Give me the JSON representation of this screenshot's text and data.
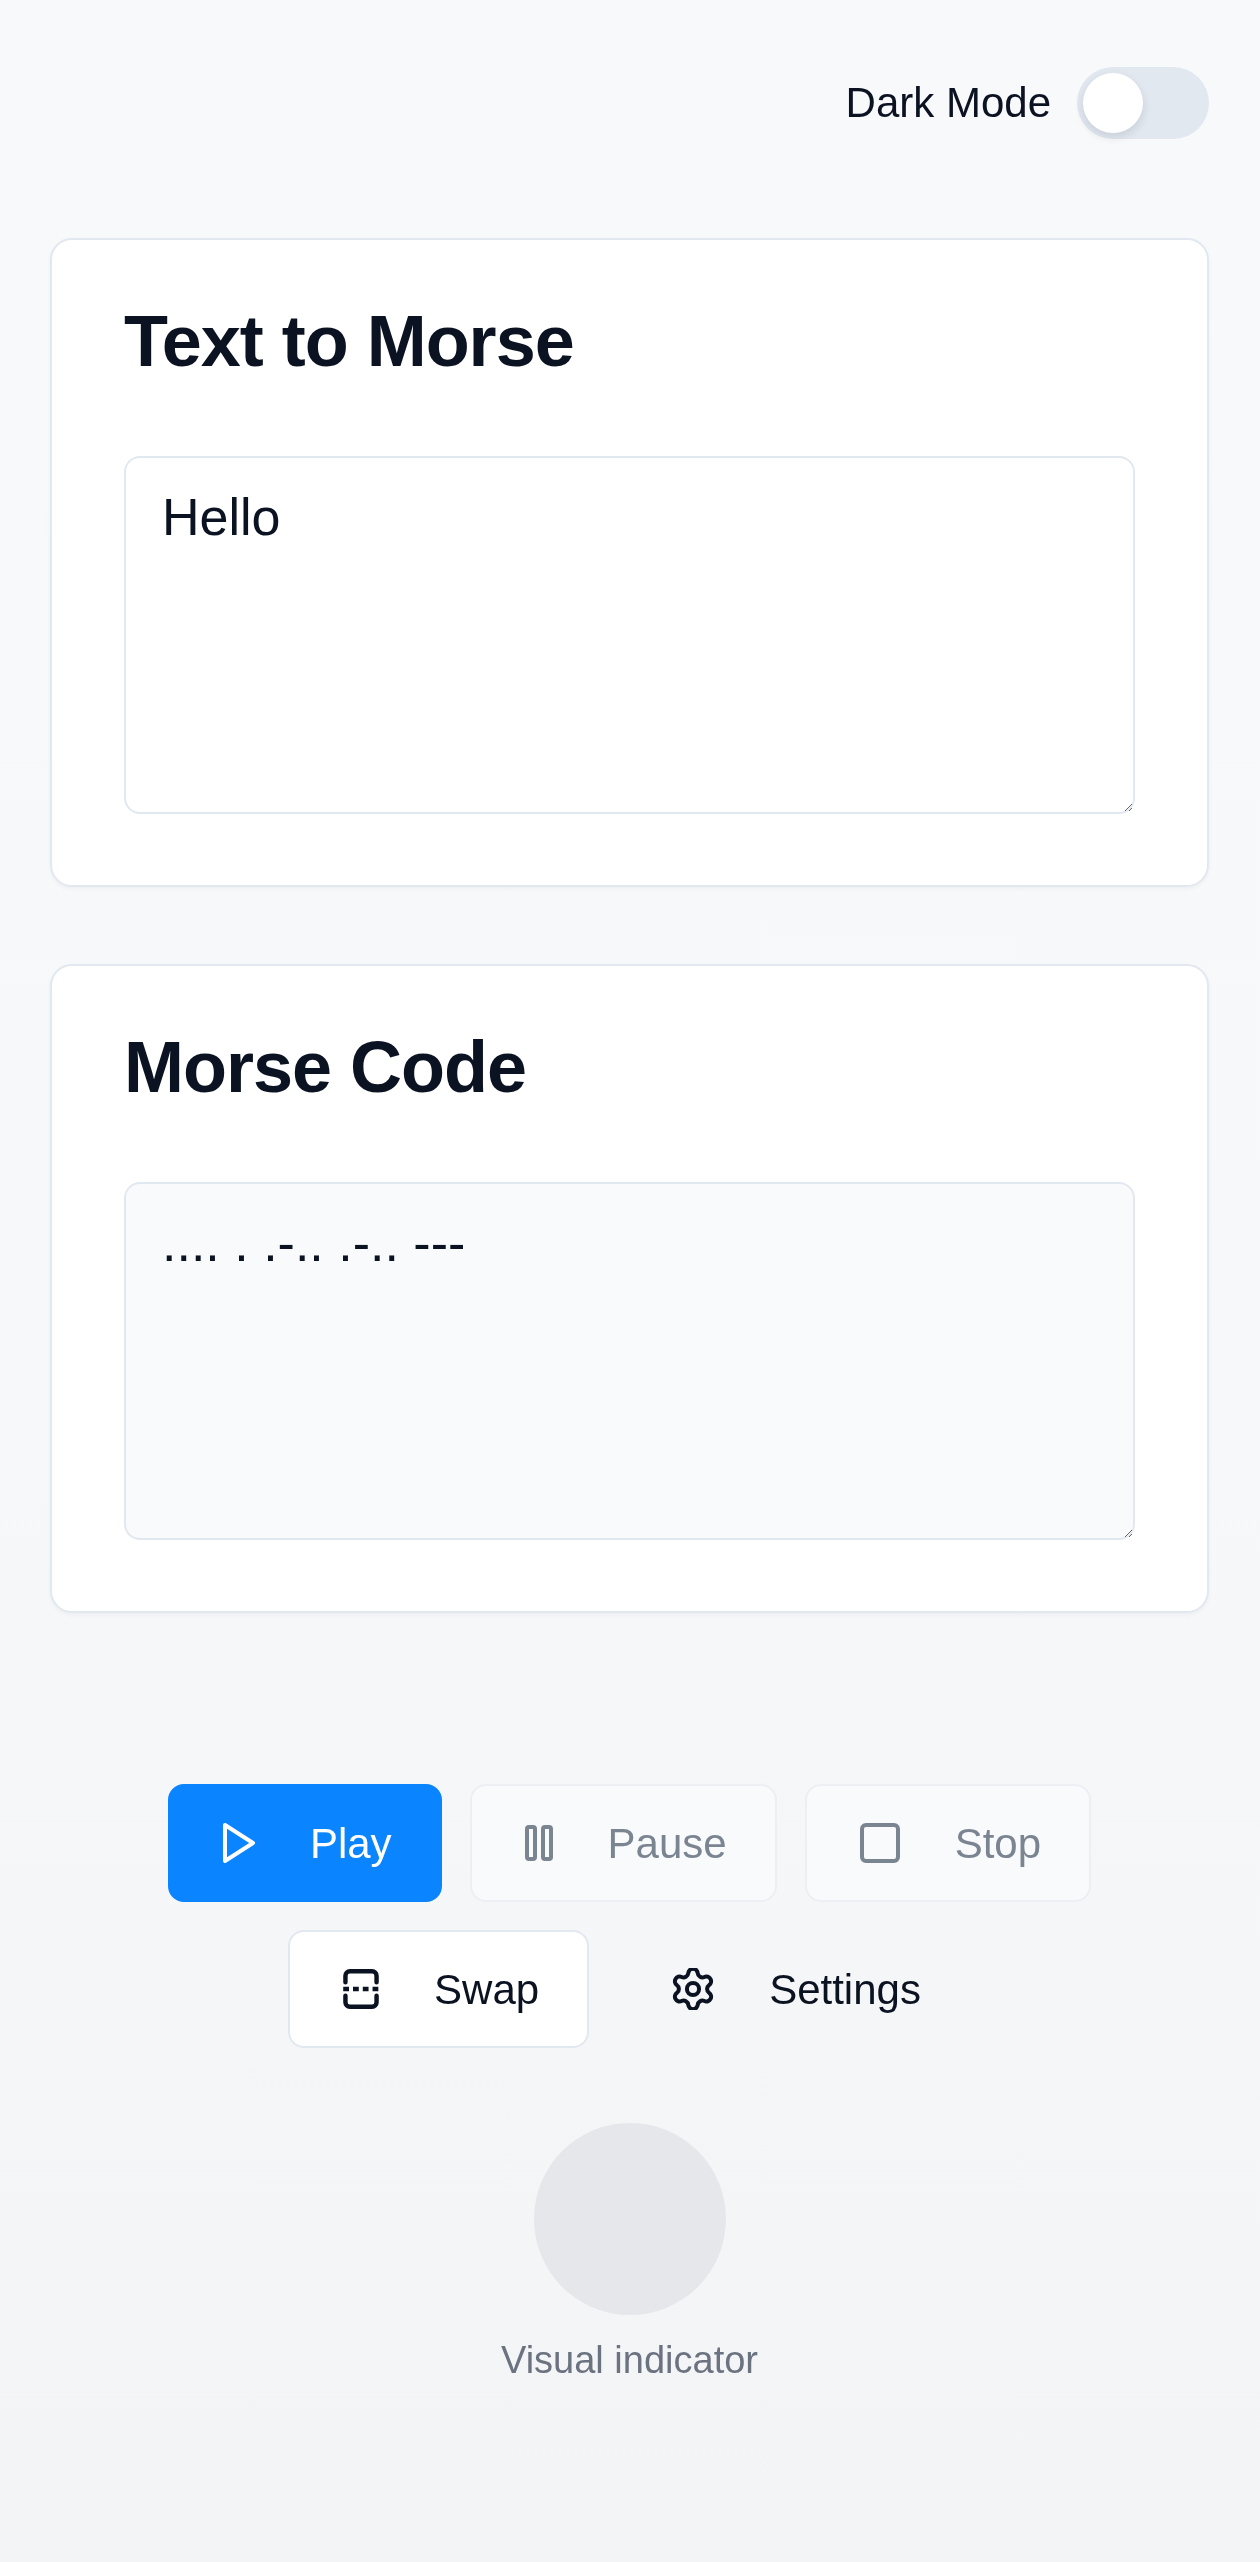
{
  "header": {
    "dark_mode": {
      "label": "Dark Mode",
      "on": false
    }
  },
  "panels": [
    {
      "title": "Text to Morse",
      "field": {
        "kind": "input",
        "value": "Hello"
      }
    },
    {
      "title": "Morse Code",
      "field": {
        "kind": "output",
        "value": ".... . .-.. .-.. ---"
      }
    }
  ],
  "controls": [
    {
      "label": "Play",
      "kind": "primary",
      "disabled": false
    },
    {
      "label": "Pause",
      "kind": "secondary",
      "disabled": true
    },
    {
      "label": "Stop",
      "kind": "secondary",
      "disabled": true
    },
    {
      "label": "Swap",
      "kind": "secondary",
      "disabled": false
    },
    {
      "label": "Settings",
      "kind": "ghost",
      "disabled": false
    }
  ],
  "indicator": {
    "active": false,
    "label": "Visual indicator"
  }
}
